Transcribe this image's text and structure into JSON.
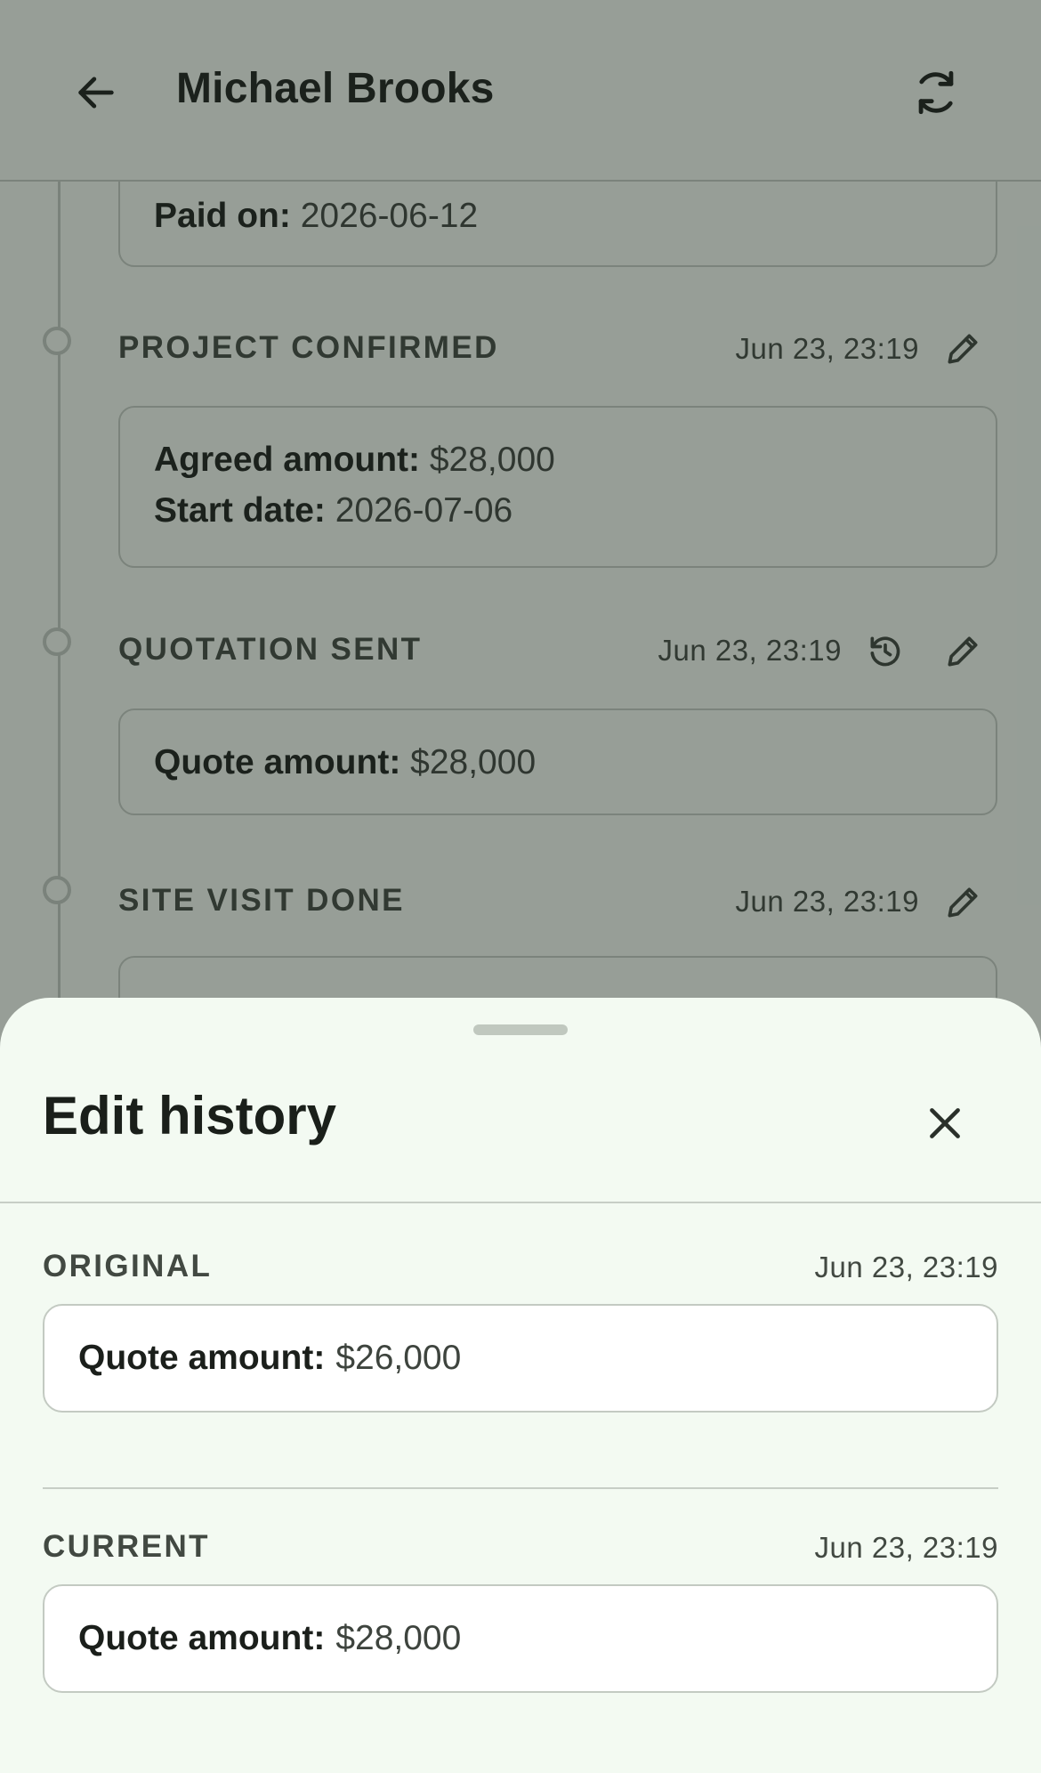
{
  "appbar": {
    "title": "Michael Brooks",
    "back_icon": "arrow-left-icon",
    "refresh_icon": "sync-icon"
  },
  "timeline": {
    "paid_card": {
      "label": "Paid on:",
      "value": "2026-06-12"
    },
    "events": [
      {
        "title": "PROJECT CONFIRMED",
        "time": "Jun 23, 23:19",
        "fields": [
          {
            "label": "Agreed amount:",
            "value": "$28,000"
          },
          {
            "label": "Start date:",
            "value": "2026-07-06"
          }
        ]
      },
      {
        "title": "QUOTATION SENT",
        "time": "Jun 23, 23:19",
        "fields": [
          {
            "label": "Quote amount:",
            "value": "$28,000"
          }
        ]
      },
      {
        "title": "SITE VISIT DONE",
        "time": "Jun 23, 23:19"
      }
    ]
  },
  "sheet": {
    "title": "Edit history",
    "close_icon": "close-icon",
    "original": {
      "label": "ORIGINAL",
      "time": "Jun 23, 23:19",
      "field_label": "Quote amount:",
      "field_value": "$26,000"
    },
    "current": {
      "label": "CURRENT",
      "time": "Jun 23, 23:19",
      "field_label": "Quote amount:",
      "field_value": "$28,000"
    }
  },
  "colors": {
    "surface": "#f4faf2",
    "scrim": "#1b251f",
    "on_surface": "#1b1f1b",
    "outline": "#c4cbc3"
  }
}
